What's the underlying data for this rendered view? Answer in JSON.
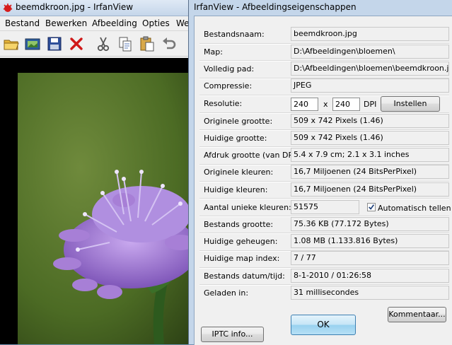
{
  "main_window": {
    "title": "beemdkroon.jpg - IrfanView",
    "menu": [
      "Bestand",
      "Bewerken",
      "Afbeelding",
      "Opties",
      "We"
    ],
    "toolbar_icons": [
      "open-folder-icon",
      "slideshow-icon",
      "save-icon",
      "delete-icon",
      "cut-icon",
      "copy-icon",
      "paste-icon",
      "undo-icon"
    ]
  },
  "dialog": {
    "title": "IrfanView - Afbeeldingseigenschappen",
    "rows": {
      "filename": {
        "label": "Bestandsnaam:",
        "value": "beemdkroon.jpg"
      },
      "folder": {
        "label": "Map:",
        "value": "D:\\Afbeeldingen\\bloemen\\"
      },
      "full_path": {
        "label": "Volledig pad:",
        "value": "D:\\Afbeeldingen\\bloemen\\beemdkroon.jpg"
      },
      "compression": {
        "label": "Compressie:",
        "value": "JPEG"
      },
      "resolution": {
        "label": "Resolutie:",
        "x": "240",
        "separator": "x",
        "y": "240",
        "unit": "DPI",
        "button": "Instellen"
      },
      "original_size": {
        "label": "Originele grootte:",
        "value": "509 x 742  Pixels (1.46)"
      },
      "current_size": {
        "label": "Huidige grootte:",
        "value": "509 x 742  Pixels (1.46)"
      },
      "print_size": {
        "label": "Afdruk grootte (van DPI):",
        "value": "5.4 x 7.9 cm; 2.1 x 3.1 inches"
      },
      "original_colors": {
        "label": "Originele kleuren:",
        "value": "16,7 Miljoenen   (24 BitsPerPixel)"
      },
      "current_colors": {
        "label": "Huidige kleuren:",
        "value": "16,7 Miljoenen   (24 BitsPerPixel)"
      },
      "unique_colors": {
        "label": "Aantal unieke kleuren:",
        "value": "51575",
        "checkbox_label": "Automatisch tellen",
        "checked": true
      },
      "file_size": {
        "label": "Bestands grootte:",
        "value": "75.36 KB (77.172 Bytes)"
      },
      "memory": {
        "label": "Huidige geheugen:",
        "value": "1.08  MB (1.133.816 Bytes)"
      },
      "folder_index": {
        "label": "Huidige map index:",
        "value": "7   /   77"
      },
      "file_date": {
        "label": "Bestands datum/tijd:",
        "value": "8-1-2010 / 01:26:58"
      },
      "load_time": {
        "label": "Geladen in:",
        "value": "31 millisecondes"
      }
    },
    "buttons": {
      "comments": "Kommentaar...",
      "ok": "OK",
      "iptc": "IPTC info..."
    }
  },
  "colors": {
    "dialog_frame": "#c4d6ea",
    "ok_button": "#98d1ef",
    "flower": "#a77fd6",
    "background_photo": "#4c6b24"
  }
}
